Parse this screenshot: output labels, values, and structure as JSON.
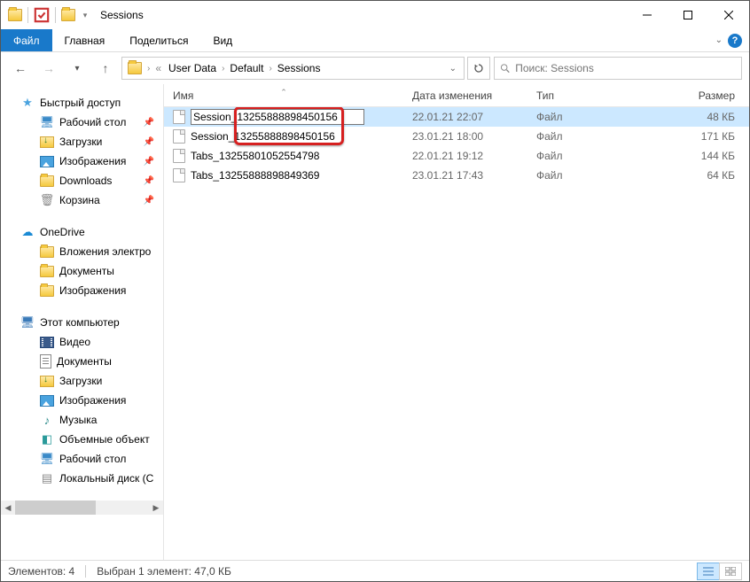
{
  "title": "Sessions",
  "menu": {
    "file": "Файл",
    "home": "Главная",
    "share": "Поделиться",
    "view": "Вид"
  },
  "breadcrumb": [
    "User Data",
    "Default",
    "Sessions"
  ],
  "search_placeholder": "Поиск: Sessions",
  "columns": {
    "name": "Имя",
    "date": "Дата изменения",
    "type": "Тип",
    "size": "Размер"
  },
  "files": [
    {
      "name": "Session_13255888898450156",
      "date": "22.01.21 22:07",
      "type": "Файл",
      "size": "48 КБ",
      "selected": true,
      "renaming": true
    },
    {
      "name": "Session_13255888898450156",
      "date": "23.01.21 18:00",
      "type": "Файл",
      "size": "171 КБ"
    },
    {
      "name": "Tabs_13255801052554798",
      "date": "22.01.21 19:12",
      "type": "Файл",
      "size": "144 КБ"
    },
    {
      "name": "Tabs_13255888898849369",
      "date": "23.01.21 17:43",
      "type": "Файл",
      "size": "64 КБ"
    }
  ],
  "sidebar": {
    "quick": {
      "label": "Быстрый доступ",
      "items": [
        {
          "label": "Рабочий стол",
          "icon": "desktop",
          "pin": true
        },
        {
          "label": "Загрузки",
          "icon": "dl",
          "pin": true
        },
        {
          "label": "Изображения",
          "icon": "img",
          "pin": true
        },
        {
          "label": "Downloads",
          "icon": "folder",
          "pin": true
        },
        {
          "label": "Корзина",
          "icon": "trash",
          "pin": true
        }
      ]
    },
    "onedrive": {
      "label": "OneDrive",
      "items": [
        {
          "label": "Вложения электро",
          "icon": "folder"
        },
        {
          "label": "Документы",
          "icon": "folder"
        },
        {
          "label": "Изображения",
          "icon": "folder"
        }
      ]
    },
    "pc": {
      "label": "Этот компьютер",
      "items": [
        {
          "label": "Видео",
          "icon": "video"
        },
        {
          "label": "Документы",
          "icon": "doc"
        },
        {
          "label": "Загрузки",
          "icon": "dl"
        },
        {
          "label": "Изображения",
          "icon": "img"
        },
        {
          "label": "Музыка",
          "icon": "music"
        },
        {
          "label": "Объемные объект",
          "icon": "cube"
        },
        {
          "label": "Рабочий стол",
          "icon": "desktop"
        },
        {
          "label": "Локальный диск (С",
          "icon": "drive"
        }
      ]
    }
  },
  "status": {
    "count": "Элементов: 4",
    "selected": "Выбран 1 элемент: 47,0 КБ"
  }
}
